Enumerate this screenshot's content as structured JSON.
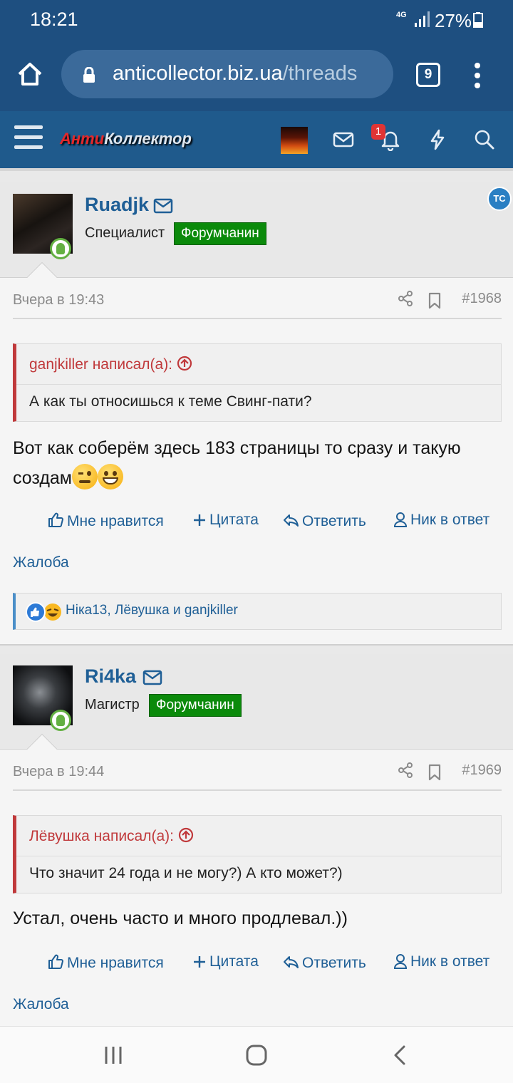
{
  "status_bar": {
    "time": "18:21",
    "network": "4G",
    "battery": "27%"
  },
  "browser": {
    "url_host": "anticollector.biz.ua",
    "url_path": "/threads",
    "tab_count": "9"
  },
  "site": {
    "logo_part1": "Анти",
    "logo_part2": "Коллектор",
    "alert_count": "1"
  },
  "posts": [
    {
      "username": "Ruadjk",
      "user_title": "Специалист",
      "user_badge": "Форумчанин",
      "date": "Вчера в 19:43",
      "post_number": "#1968",
      "quote_author": "ganjkiller написал(а):",
      "quote_text": "А как ты относишься к теме Свинг-пати?",
      "message": "Вот как соберём здесь 183 страницы то сразу и такую создам",
      "reactions": "Ніка13, Лёвушка и ganjkiller"
    },
    {
      "username": "Ri4ka",
      "user_title": "Магистр",
      "user_badge": "Форумчанин",
      "date": "Вчера в 19:44",
      "post_number": "#1969",
      "quote_author": "Лёвушка написал(а):",
      "quote_text": "Что значит 24 года и не могу?) А кто может?)",
      "message": "Устал, очень часто и много продлевал.))"
    }
  ],
  "actions": {
    "like": "Мне нравится",
    "quote": "Цитата",
    "reply": "Ответить",
    "mention": "Ник в ответ",
    "report": "Жалоба"
  },
  "colors": {
    "brand": "#1f5a8c",
    "link": "#1f5f96",
    "quote_accent": "#c0393b",
    "badge": "#0b8a0b"
  }
}
